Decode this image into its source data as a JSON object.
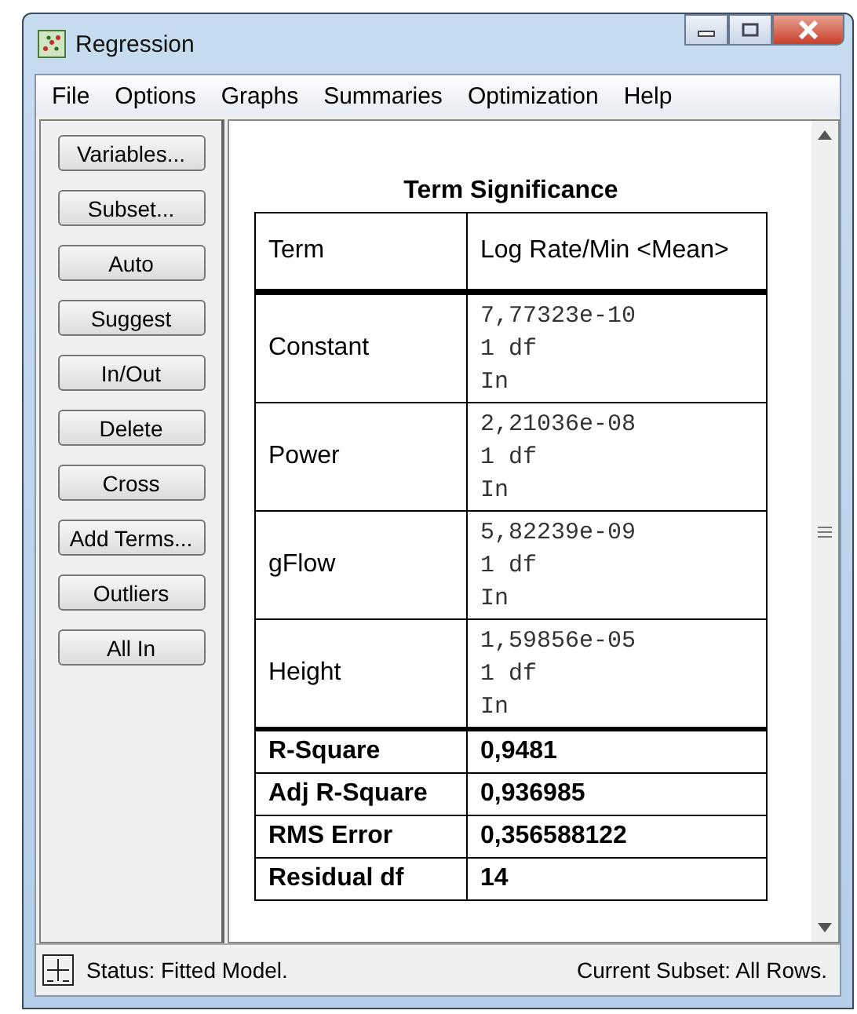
{
  "window": {
    "title": "Regression"
  },
  "menu": [
    "File",
    "Options",
    "Graphs",
    "Summaries",
    "Optimization",
    "Help"
  ],
  "buttons": [
    "Variables...",
    "Subset...",
    "Auto",
    "Suggest",
    "In/Out",
    "Delete",
    "Cross",
    "Add Terms...",
    "Outliers",
    "All In"
  ],
  "table": {
    "title": "Term Significance",
    "columns": [
      "Term",
      "Log Rate/Min <Mean>"
    ],
    "rows": [
      {
        "term": "Constant",
        "lines": [
          "7,77323e-10",
          "1 df",
          "In"
        ]
      },
      {
        "term": "Power",
        "lines": [
          "2,21036e-08",
          "1 df",
          "In"
        ]
      },
      {
        "term": "gFlow",
        "lines": [
          "5,82239e-09",
          "1 df",
          "In"
        ]
      },
      {
        "term": "Height",
        "lines": [
          "1,59856e-05",
          "1 df",
          "In"
        ]
      }
    ],
    "stats": [
      {
        "label": "R-Square",
        "value": "0,9481"
      },
      {
        "label": "Adj R-Square",
        "value": "0,936985"
      },
      {
        "label": "RMS Error",
        "value": "0,356588122"
      },
      {
        "label": "Residual df",
        "value": "14"
      }
    ]
  },
  "status_bar": {
    "left": "Status: Fitted Model.",
    "right": "Current Subset: All Rows."
  }
}
